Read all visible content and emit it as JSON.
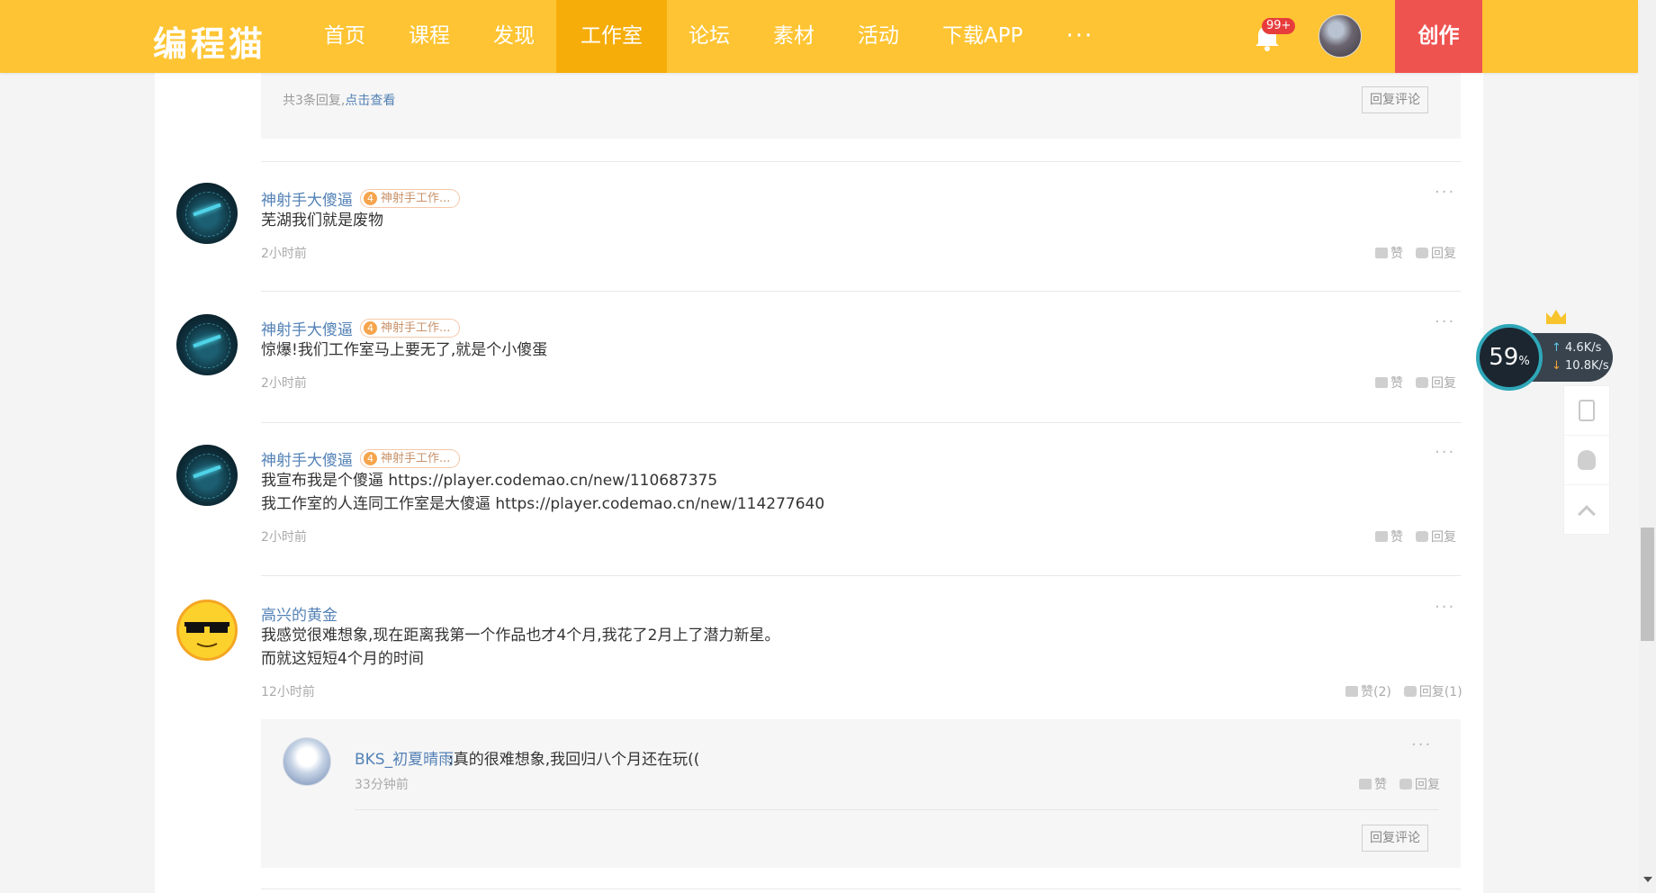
{
  "header": {
    "logo": "编程猫",
    "nav": [
      "首页",
      "课程",
      "发现",
      "工作室",
      "论坛",
      "素材",
      "活动",
      "下载APP"
    ],
    "nav_more": "···",
    "notification_badge": "99+",
    "create_label": "创作",
    "brand_color": "#fec433",
    "active_tab": "工作室"
  },
  "top_reply_block": {
    "count_text": "共3条回复,",
    "view_link": "点击查看",
    "reply_button": "回复评论"
  },
  "comments": [
    {
      "name": "神射手大傻逼",
      "tag_level": "4",
      "tag_text": "神射手工作...",
      "lines": [
        "芜湖我们就是废物"
      ],
      "time": "2小时前",
      "like": "赞",
      "reply": "回复"
    },
    {
      "name": "神射手大傻逼",
      "tag_level": "4",
      "tag_text": "神射手工作...",
      "lines": [
        "惊爆!我们工作室马上要无了,就是个小傻蛋"
      ],
      "time": "2小时前",
      "like": "赞",
      "reply": "回复"
    },
    {
      "name": "神射手大傻逼",
      "tag_level": "4",
      "tag_text": "神射手工作...",
      "lines": [
        "我宣布我是个傻逼 https://player.codemao.cn/new/110687375",
        "我工作室的人连同工作室是大傻逼 https://player.codemao.cn/new/114277640"
      ],
      "time": "2小时前",
      "like": "赞",
      "reply": "回复"
    },
    {
      "name": "高兴的黄金",
      "lines": [
        "我感觉很难想象,现在距离我第一个作品也才4个月,我花了2月上了潜力新星。",
        "而就这短短4个月的时间"
      ],
      "time": "12小时前",
      "like": "赞(2)",
      "reply": "回复(1)"
    }
  ],
  "sub_reply": {
    "name": "BKS_初夏晴雨",
    "text": ":真的很难想象,我回归八个月还在玩((",
    "time": "33分钟前",
    "like": "赞",
    "reply": "回复",
    "reply_button": "回复评论"
  },
  "net_widget": {
    "percent": "59",
    "percent_unit": "%",
    "up": "4.6K/s",
    "down": "10.8K/s"
  },
  "side_tools": [
    "phone-icon",
    "qq-icon",
    "back-to-top-icon"
  ]
}
